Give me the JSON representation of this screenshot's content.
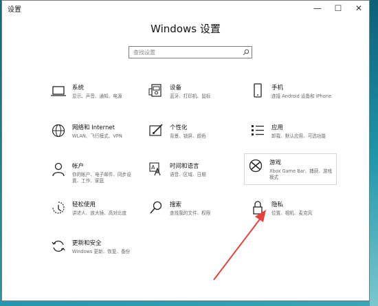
{
  "window": {
    "title": "设置",
    "minimize": "—",
    "maximize": "☐",
    "close": "✕"
  },
  "heading": "Windows 设置",
  "search": {
    "placeholder": "查找设置"
  },
  "tiles": [
    {
      "name": "系统",
      "desc": "显示、声音、通知、电源",
      "icon": "laptop-icon"
    },
    {
      "name": "设备",
      "desc": "蓝牙、打印机、鼠标",
      "icon": "devices-icon"
    },
    {
      "name": "手机",
      "desc": "连接 Android 设备和 iPhone",
      "icon": "phone-icon"
    },
    {
      "name": "网络和 Internet",
      "desc": "WLAN、飞行模式、VPN",
      "icon": "globe-icon"
    },
    {
      "name": "个性化",
      "desc": "背景、锁屏、颜色",
      "icon": "paintbrush-icon"
    },
    {
      "name": "应用",
      "desc": "卸载、默认应用、可选功能",
      "icon": "apps-list-icon"
    },
    {
      "name": "帐户",
      "desc": "你的帐户、电子邮件、同步设置、工作、家庭",
      "icon": "person-icon"
    },
    {
      "name": "时间和语言",
      "desc": "语音、区域、日期",
      "icon": "time-language-icon"
    },
    {
      "name": "游戏",
      "desc": "Xbox Game Bar、捕获、游戏模式",
      "icon": "xbox-icon"
    },
    {
      "name": "轻松使用",
      "desc": "讲述人、放大镜、高对比度",
      "icon": "ease-of-access-icon"
    },
    {
      "name": "搜索",
      "desc": "查找我的文件、权限",
      "icon": "search-icon"
    },
    {
      "name": "隐私",
      "desc": "位置、相机、麦克风",
      "icon": "lock-icon"
    },
    {
      "name": "更新和安全",
      "desc": "Windows 更新、恢复、备份",
      "icon": "sync-icon"
    }
  ],
  "colors": {
    "arrow": "#e8413c",
    "window_bg": "#ffffff",
    "accent": "#0b6a86"
  }
}
